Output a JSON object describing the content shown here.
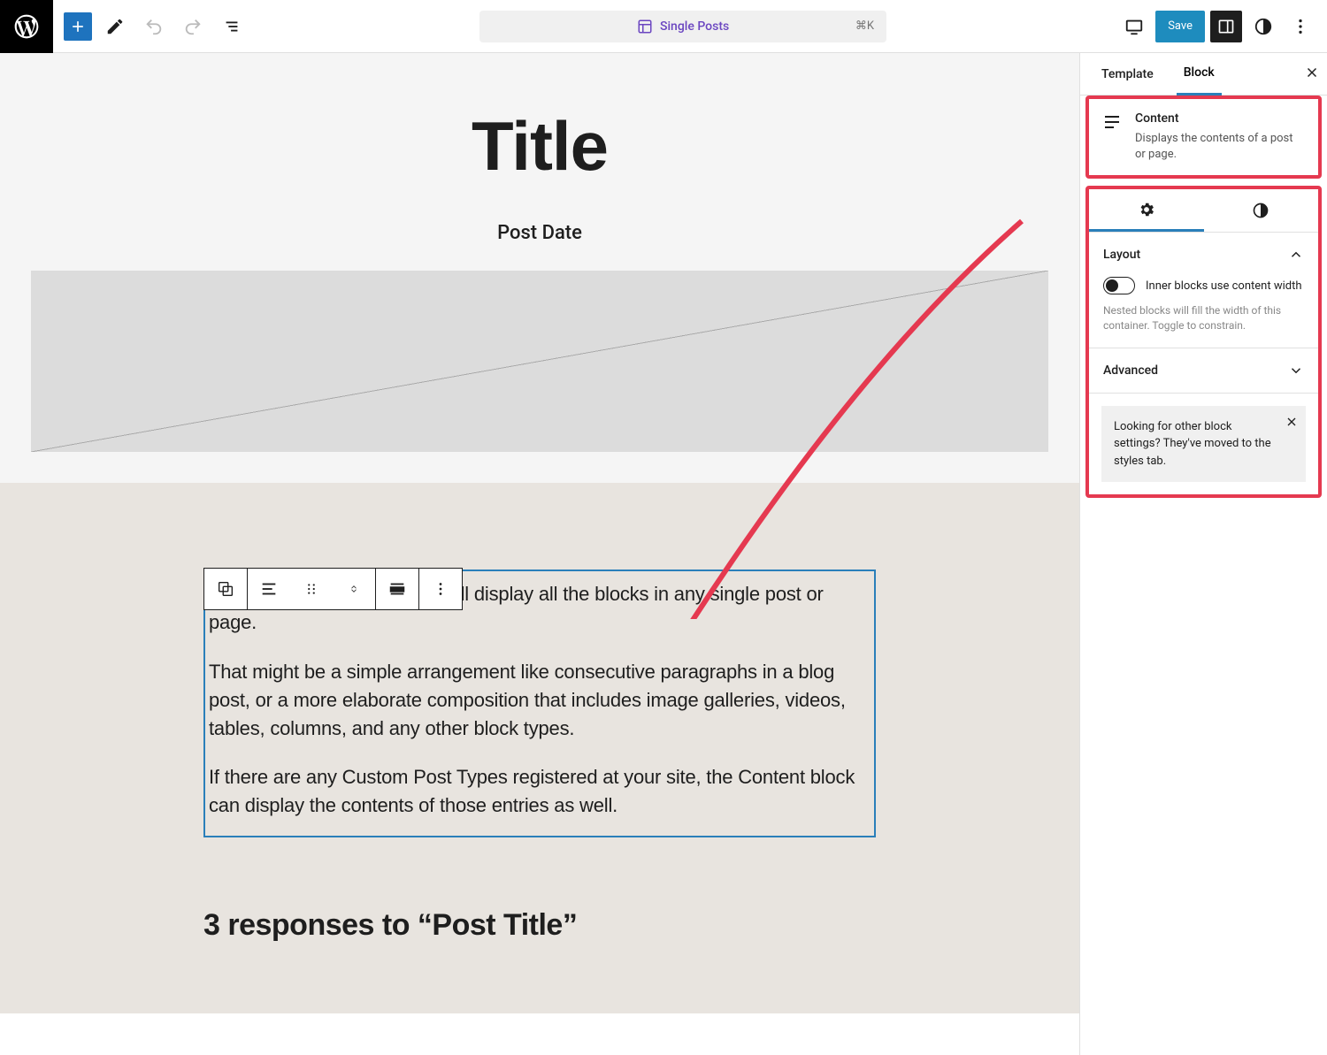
{
  "topbar": {
    "doc_title": "Single Posts",
    "shortcut": "⌘K",
    "save_label": "Save"
  },
  "canvas": {
    "title": "Title",
    "post_date_label": "Post Date",
    "content_paragraphs": [
      "This is the Content block, it will display all the blocks in any single post or page.",
      "That might be a simple arrangement like consecutive paragraphs in a blog post, or a more elaborate composition that includes image galleries, videos, tables, columns, and any other block types.",
      "If there are any Custom Post Types registered at your site, the Content block can display the contents of those entries as well."
    ],
    "comments_heading": "3 responses to “Post Title”"
  },
  "sidebar": {
    "tabs": {
      "template": "Template",
      "block": "Block"
    },
    "block_info": {
      "name": "Content",
      "desc": "Displays the contents of a post or page."
    },
    "panels": {
      "layout": {
        "label": "Layout",
        "toggle_label": "Inner blocks use content width",
        "hint": "Nested blocks will fill the width of this container. Toggle to constrain."
      },
      "advanced": {
        "label": "Advanced"
      }
    },
    "notice": "Looking for other block settings? They've moved to the styles tab."
  },
  "colors": {
    "accent": "#2a7fba",
    "highlight": "#e53950"
  }
}
